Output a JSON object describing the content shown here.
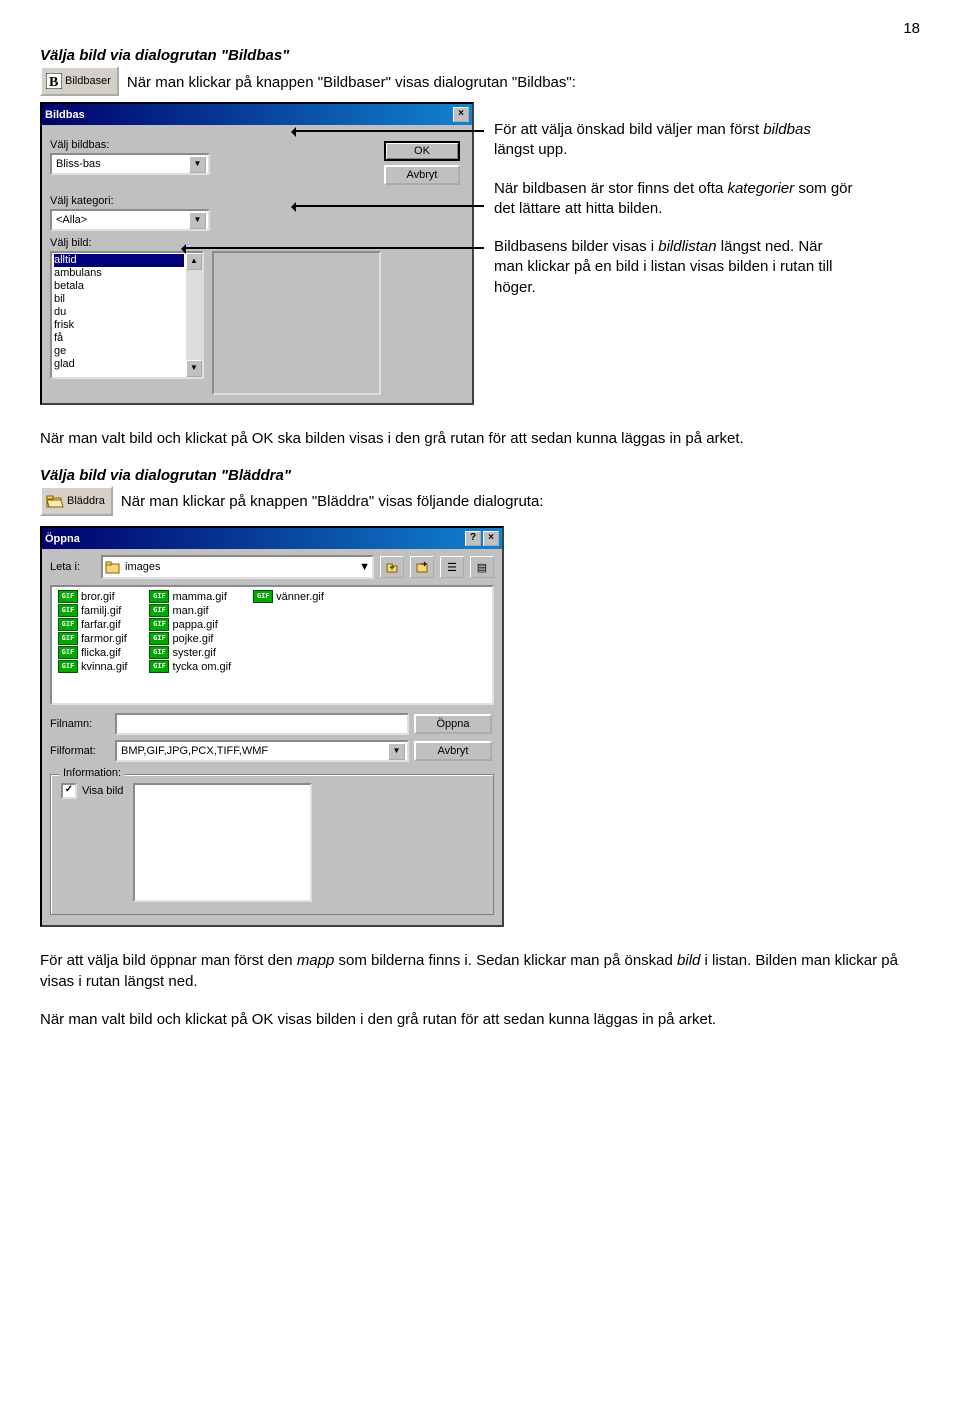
{
  "page_number": "18",
  "section1": {
    "heading": "Välja bild via dialogrutan \"Bildbas\"",
    "toolbtn": "Bildbaser",
    "para": "När man klickar på knappen \"Bildbaser\" visas dialogrutan \"Bildbas\":"
  },
  "dialog1": {
    "title": "Bildbas",
    "lbl_valj_bildbas": "Välj bildbas:",
    "bildbas": "Bliss-bas",
    "lbl_valj_kategori": "Välj kategori:",
    "kategori": "<Alla>",
    "lbl_valj_bild": "Välj bild:",
    "list": [
      "alltid",
      "ambulans",
      "betala",
      "bil",
      "du",
      "frisk",
      "få",
      "ge",
      "glad"
    ],
    "ok": "OK",
    "avbryt": "Avbryt"
  },
  "annot1": {
    "p1a": "För att välja önskad bild väljer man först ",
    "p1b": "bildbas",
    "p1c": " längst upp.",
    "p2a": "När bildbasen är stor finns det ofta ",
    "p2b": "kategorier",
    "p2c": " som gör det lättare att hitta bilden.",
    "p3a": "Bildbasens bilder visas i ",
    "p3b": "bildlistan",
    "p3c": " längst ned. När man klickar på en bild i listan visas bilden i rutan till höger."
  },
  "mid_para": "När man valt bild och klickat på OK ska bilden visas i den grå rutan för att sedan kunna läggas in på arket.",
  "section2": {
    "heading": "Välja bild via dialogrutan \"Bläddra\"",
    "toolbtn": "Bläddra",
    "para": "När man klickar på knappen \"Bläddra\" visas följande dialogruta:"
  },
  "dialog2": {
    "title": "Öppna",
    "look_in_lbl": "Leta i:",
    "folder": "images",
    "files_col1": [
      "bror.gif",
      "familj.gif",
      "farfar.gif",
      "farmor.gif",
      "flicka.gif",
      "kvinna.gif"
    ],
    "files_col2": [
      "mamma.gif",
      "man.gif",
      "pappa.gif",
      "pojke.gif",
      "syster.gif",
      "tycka om.gif"
    ],
    "files_col3": [
      "vänner.gif"
    ],
    "lbl_filnamn": "Filnamn:",
    "filnamn": "",
    "lbl_filformat": "Filformat:",
    "filformat": "BMP,GIF,JPG,PCX,TIFF,WMF",
    "oppna": "Öppna",
    "avbryt": "Avbryt",
    "info": "Information:",
    "visa_bild": "Visa bild"
  },
  "trailer": {
    "p1a": "För att välja bild öppnar man först den ",
    "p1b": "mapp",
    "p1c": " som bilderna finns i. Sedan klickar man på önskad ",
    "p1d": "bild",
    "p1e": " i listan. Bilden man klickar på visas i rutan längst ned.",
    "p2": "När man valt bild och klickat på OK visas bilden i den grå rutan för att sedan kunna läggas in på arket."
  }
}
